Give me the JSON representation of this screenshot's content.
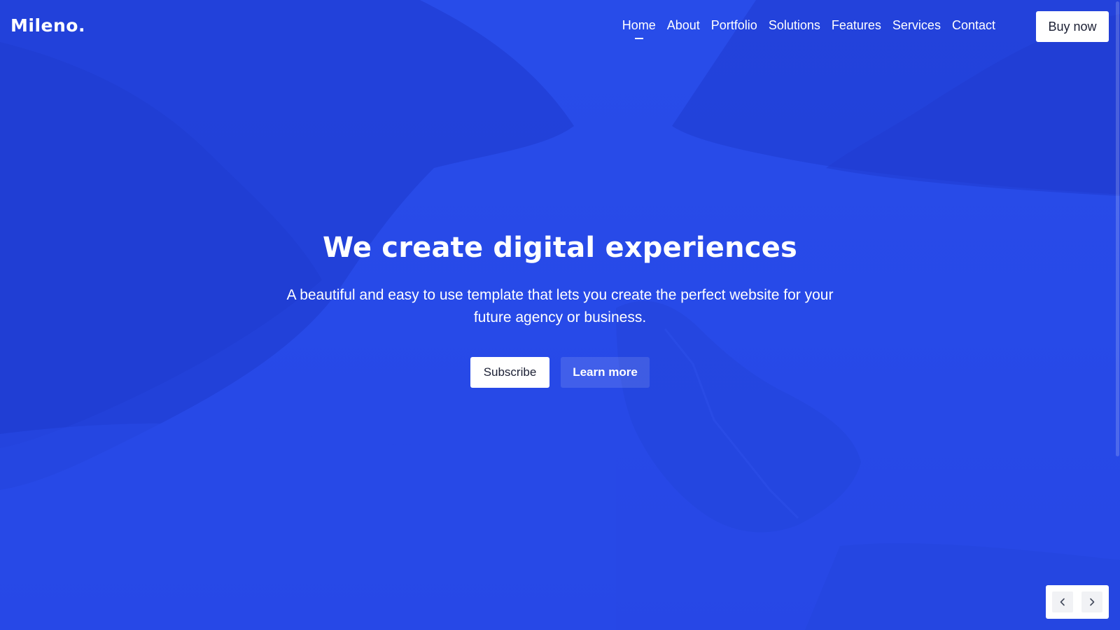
{
  "brand": {
    "logo_text": "Mileno.",
    "accent_color": "#2a4ee8"
  },
  "nav": {
    "items": [
      {
        "label": "Home",
        "active": true
      },
      {
        "label": "About",
        "active": false
      },
      {
        "label": "Portfolio",
        "active": false
      },
      {
        "label": "Solutions",
        "active": false
      },
      {
        "label": "Features",
        "active": false
      },
      {
        "label": "Services",
        "active": false
      },
      {
        "label": "Contact",
        "active": false
      }
    ],
    "cta_label": "Buy now"
  },
  "hero": {
    "title": "We create digital experiences",
    "subtitle": "A beautiful and easy to use template that lets you create the perfect website for your future agency or business.",
    "primary_button": "Subscribe",
    "secondary_button": "Learn more"
  },
  "slider": {
    "prev_icon": "chevron-left-icon",
    "next_icon": "chevron-right-icon"
  }
}
